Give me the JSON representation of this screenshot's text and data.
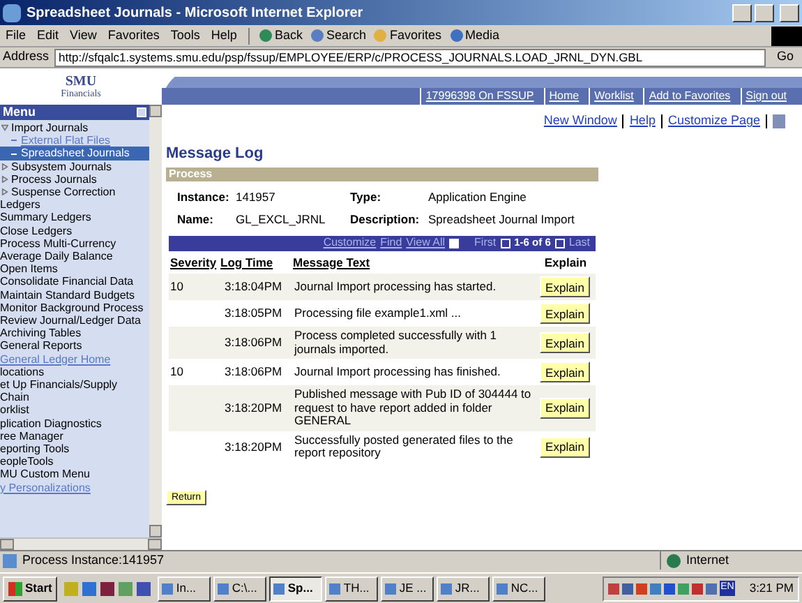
{
  "window": {
    "title": "Spreadsheet Journals - Microsoft Internet Explorer"
  },
  "menu_bar": [
    "File",
    "Edit",
    "View",
    "Favorites",
    "Tools",
    "Help"
  ],
  "toolbar": [
    {
      "label": "Back",
      "kind": "back"
    },
    {
      "label": "Search",
      "kind": "search"
    },
    {
      "label": "Favorites",
      "kind": "favorites"
    },
    {
      "label": "Media",
      "kind": "media"
    }
  ],
  "address": {
    "label": "Address",
    "value": "http://sfqalc1.systems.smu.edu/psp/fssup/EMPLOYEE/ERP/c/PROCESS_JOURNALS.LOAD_JRNL_DYN.GBL",
    "go": "Go"
  },
  "header": {
    "logo": "SMU",
    "logo_subtitle": "Financials",
    "links": [
      "17996398 On FSSUP",
      "Home",
      "Worklist",
      "Add to Favorites",
      "Sign out"
    ]
  },
  "sidebar": {
    "title": "Menu",
    "items": [
      {
        "label": "Import Journals",
        "kind": "folder",
        "expanded": true,
        "children": [
          {
            "label": "External Flat Files",
            "kind": "link",
            "selected": false
          },
          {
            "label": "Spreadsheet Journals",
            "kind": "link",
            "selected": true
          }
        ]
      },
      {
        "label": "Subsystem Journals",
        "kind": "folder",
        "expanded": false
      },
      {
        "label": "Process Journals",
        "kind": "folder",
        "expanded": false
      },
      {
        "label": "Suspense Correction",
        "kind": "folder",
        "expanded": false
      },
      {
        "label": "Ledgers",
        "kind": "item"
      },
      {
        "label": "Summary Ledgers",
        "kind": "item"
      },
      {
        "label": "Close Ledgers",
        "kind": "item"
      },
      {
        "label": "Process Multi-Currency",
        "kind": "item"
      },
      {
        "label": "Average Daily Balance",
        "kind": "item"
      },
      {
        "label": "Open Items",
        "kind": "item"
      },
      {
        "label": "Consolidate Financial Data",
        "kind": "item"
      },
      {
        "label": "Maintain Standard Budgets",
        "kind": "item"
      },
      {
        "label": "Monitor Background Process",
        "kind": "item"
      },
      {
        "label": "Review Journal/Ledger Data",
        "kind": "item"
      },
      {
        "label": "Archiving Tables",
        "kind": "item"
      },
      {
        "label": "General Reports",
        "kind": "item"
      },
      {
        "label": "General Ledger Home",
        "kind": "link"
      },
      {
        "label": "locations",
        "kind": "item"
      },
      {
        "label": "et Up Financials/Supply Chain",
        "kind": "item"
      },
      {
        "label": "orklist",
        "kind": "item"
      },
      {
        "label": "plication Diagnostics",
        "kind": "item"
      },
      {
        "label": "ree Manager",
        "kind": "item"
      },
      {
        "label": "eporting Tools",
        "kind": "item"
      },
      {
        "label": "eopleTools",
        "kind": "item"
      },
      {
        "label": "MU Custom Menu",
        "kind": "item"
      },
      {
        "label": "y Personalizations",
        "kind": "link"
      }
    ]
  },
  "page_links": [
    "New Window",
    "Help",
    "Customize Page"
  ],
  "page_title": "Message Log",
  "process": {
    "title": "Process",
    "fields": [
      {
        "label": "Instance:",
        "value": "141957"
      },
      {
        "label": "Type:",
        "value": "Application Engine"
      },
      {
        "label": "Name:",
        "value": "GL_EXCL_JRNL"
      },
      {
        "label": "Description:",
        "value": "Spreadsheet Journal Import"
      }
    ]
  },
  "grid": {
    "links": [
      "Customize",
      "Find",
      "View All"
    ],
    "first": "First",
    "range": "1-6 of 6",
    "last": "Last",
    "columns": [
      "Severity",
      "Log Time",
      "Message Text",
      "Explain"
    ],
    "rows": [
      {
        "severity": "10",
        "time": "3:18:04PM",
        "message": "Journal Import processing has started.",
        "button": "Explain"
      },
      {
        "severity": "",
        "time": "3:18:05PM",
        "message": "Processing file example1.xml ...",
        "button": "Explain"
      },
      {
        "severity": "",
        "time": "3:18:06PM",
        "message": "Process completed successfully with 1 journals imported.",
        "button": "Explain"
      },
      {
        "severity": "10",
        "time": "3:18:06PM",
        "message": "Journal Import processing has finished.",
        "button": "Explain"
      },
      {
        "severity": "",
        "time": "3:18:20PM",
        "message": "Published message with  Pub ID of 304444 to request to have report  added in folder GENERAL",
        "button": "Explain"
      },
      {
        "severity": "",
        "time": "3:18:20PM",
        "message": "Successfully posted generated files to the report repository",
        "button": "Explain"
      }
    ]
  },
  "return_button": "Return",
  "status_bar": {
    "text": "Process Instance:141957",
    "zone": "Internet"
  },
  "taskbar": {
    "start": "Start",
    "tasks": [
      {
        "label": "In...",
        "selected": false
      },
      {
        "label": "C:\\...",
        "selected": false
      },
      {
        "label": "Sp...",
        "selected": true
      },
      {
        "label": "TH...",
        "selected": false
      },
      {
        "label": "JE ...",
        "selected": false
      },
      {
        "label": "JR...",
        "selected": false
      },
      {
        "label": "NC...",
        "selected": false
      }
    ],
    "language": "EN",
    "clock": "3:21 PM"
  }
}
